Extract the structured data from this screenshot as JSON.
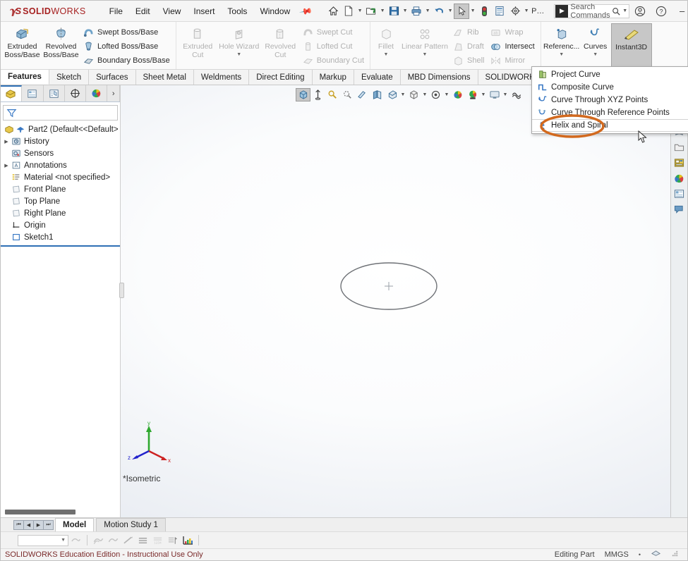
{
  "app": {
    "brand_ds": "2S",
    "brand_solid": "SOLID",
    "brand_works": "WORKS",
    "accent_color": "#a62121",
    "highlight_color": "#d2691e"
  },
  "menubar": {
    "items": [
      {
        "label": "File",
        "name": "menu-file"
      },
      {
        "label": "Edit",
        "name": "menu-edit"
      },
      {
        "label": "View",
        "name": "menu-view"
      },
      {
        "label": "Insert",
        "name": "menu-insert"
      },
      {
        "label": "Tools",
        "name": "menu-tools"
      },
      {
        "label": "Window",
        "name": "menu-window"
      }
    ],
    "pin_icon": "pin-icon"
  },
  "quick_access": {
    "icons": [
      {
        "name": "home-icon",
        "glyph": "⌂"
      },
      {
        "name": "new-document-icon",
        "glyph": "□"
      },
      {
        "name": "open-folder-icon",
        "glyph": "▶"
      },
      {
        "name": "save-icon",
        "glyph": "■"
      },
      {
        "name": "print-icon",
        "glyph": "⎙"
      },
      {
        "name": "undo-icon",
        "glyph": "↶"
      },
      {
        "name": "select-arrow-icon",
        "glyph": "➤"
      },
      {
        "name": "rebuild-traffic-icon",
        "glyph": "●"
      },
      {
        "name": "options-list-icon",
        "glyph": "☰"
      },
      {
        "name": "settings-gear-icon",
        "glyph": "⚙"
      },
      {
        "name": "part-label-icon",
        "glyph": "P…"
      }
    ]
  },
  "search": {
    "placeholder": "Search Commands",
    "search_icon": "magnifier-icon",
    "dropdown_icon": "chevron-down-icon",
    "swk_icon": "solidworks-search-icon"
  },
  "window_controls": {
    "account_icon": "user-account-icon",
    "help_icon": "help-question-icon",
    "minimize": "–",
    "maximize": "☐",
    "close": "✕"
  },
  "ribbon": {
    "groups": [
      {
        "name": "boss-base-group",
        "big": [
          {
            "label_line1": "Extruded",
            "label_line2": "Boss/Base",
            "name": "extruded-boss-base-button",
            "disabled": false
          },
          {
            "label_line1": "Revolved",
            "label_line2": "Boss/Base",
            "name": "revolved-boss-base-button",
            "disabled": false
          }
        ],
        "small": [
          {
            "label": "Swept Boss/Base",
            "name": "swept-boss-base-button",
            "disabled": false
          },
          {
            "label": "Lofted Boss/Base",
            "name": "lofted-boss-base-button",
            "disabled": false
          },
          {
            "label": "Boundary Boss/Base",
            "name": "boundary-boss-base-button",
            "disabled": false
          }
        ]
      },
      {
        "name": "cut-group",
        "big": [
          {
            "label_line1": "Extruded",
            "label_line2": "Cut",
            "name": "extruded-cut-button",
            "disabled": true
          },
          {
            "label_line1": "Hole Wizard",
            "label_line2": "",
            "name": "hole-wizard-button",
            "disabled": true
          },
          {
            "label_line1": "Revolved",
            "label_line2": "Cut",
            "name": "revolved-cut-button",
            "disabled": true
          }
        ],
        "small": [
          {
            "label": "Swept Cut",
            "name": "swept-cut-button",
            "disabled": true
          },
          {
            "label": "Lofted Cut",
            "name": "lofted-cut-button",
            "disabled": true
          },
          {
            "label": "Boundary Cut",
            "name": "boundary-cut-button",
            "disabled": true
          }
        ]
      },
      {
        "name": "features-group",
        "big": [
          {
            "label_line1": "Fillet",
            "label_line2": "",
            "name": "fillet-button",
            "disabled": true
          },
          {
            "label_line1": "Linear Pattern",
            "label_line2": "",
            "name": "linear-pattern-button",
            "disabled": true
          }
        ],
        "small": [
          {
            "label": "Rib",
            "name": "rib-button",
            "disabled": true
          },
          {
            "label": "Draft",
            "name": "draft-button",
            "disabled": true
          },
          {
            "label": "Shell",
            "name": "shell-button",
            "disabled": true
          }
        ],
        "small2": [
          {
            "label": "Wrap",
            "name": "wrap-button",
            "disabled": true
          },
          {
            "label": "Intersect",
            "name": "intersect-button",
            "disabled": false
          },
          {
            "label": "Mirror",
            "name": "mirror-button",
            "disabled": true
          }
        ]
      },
      {
        "name": "geometry-group",
        "big": [
          {
            "label_line1": "Referenc...",
            "label_line2": "",
            "name": "reference-geometry-button",
            "disabled": false
          },
          {
            "label_line1": "Curves",
            "label_line2": "",
            "name": "curves-button",
            "disabled": false
          },
          {
            "label_line1": "Instant3D",
            "label_line2": "",
            "name": "instant3d-button",
            "disabled": false
          }
        ]
      }
    ],
    "tabs": [
      {
        "label": "Features",
        "name": "tab-features",
        "active": true
      },
      {
        "label": "Sketch",
        "name": "tab-sketch",
        "active": false
      },
      {
        "label": "Surfaces",
        "name": "tab-surfaces",
        "active": false
      },
      {
        "label": "Sheet Metal",
        "name": "tab-sheet-metal",
        "active": false
      },
      {
        "label": "Weldments",
        "name": "tab-weldments",
        "active": false
      },
      {
        "label": "Direct Editing",
        "name": "tab-direct-editing",
        "active": false
      },
      {
        "label": "Markup",
        "name": "tab-markup",
        "active": false
      },
      {
        "label": "Evaluate",
        "name": "tab-evaluate",
        "active": false
      },
      {
        "label": "MBD Dimensions",
        "name": "tab-mbd-dimensions",
        "active": false
      },
      {
        "label": "SOLIDWORKS Add-Ins",
        "name": "tab-solidworks-add-ins",
        "active": false
      }
    ]
  },
  "curves_dropdown": {
    "items": [
      {
        "label": "Project Curve",
        "name": "menu-item-project-curve",
        "icon": "project-curve-icon",
        "highlighted": false
      },
      {
        "label": "Composite Curve",
        "name": "menu-item-composite-curve",
        "icon": "composite-curve-icon",
        "highlighted": false
      },
      {
        "label": "Curve Through XYZ Points",
        "name": "menu-item-curve-through-xyz-points",
        "icon": "curve-xyz-icon",
        "highlighted": false
      },
      {
        "label": "Curve Through Reference Points",
        "name": "menu-item-curve-through-reference-points",
        "icon": "curve-reference-icon",
        "highlighted": false
      },
      {
        "label": "Helix and Spiral",
        "name": "menu-item-helix-and-spiral",
        "icon": "helix-spiral-icon",
        "highlighted": true
      }
    ]
  },
  "feature_tree": {
    "tabs": [
      {
        "name": "tab-feature-manager-tree",
        "icon": "yellow-part-icon",
        "active": true
      },
      {
        "name": "tab-property-manager",
        "icon": "property-manager-icon",
        "active": false
      },
      {
        "name": "tab-configuration-manager",
        "icon": "configuration-manager-icon",
        "active": false
      },
      {
        "name": "tab-dimxpert-manager",
        "icon": "dimxpert-icon",
        "active": false
      },
      {
        "name": "tab-display-manager",
        "icon": "display-manager-icon",
        "active": false
      },
      {
        "name": "tab-more",
        "icon": "chevron-right-icon",
        "active": false
      }
    ],
    "filter_icon": "filter-funnel-icon",
    "nodes": [
      {
        "label": "Part2  (Default<<Default>",
        "name": "tree-node-part2",
        "indent": 0,
        "expandable": false,
        "icon": "part-icon",
        "root": true
      },
      {
        "label": "History",
        "name": "tree-node-history",
        "indent": 1,
        "expandable": true,
        "icon": "history-icon"
      },
      {
        "label": "Sensors",
        "name": "tree-node-sensors",
        "indent": 1,
        "expandable": false,
        "icon": "sensors-icon"
      },
      {
        "label": "Annotations",
        "name": "tree-node-annotations",
        "indent": 1,
        "expandable": true,
        "icon": "annotations-icon"
      },
      {
        "label": "Material <not specified>",
        "name": "tree-node-material",
        "indent": 1,
        "expandable": false,
        "icon": "material-icon"
      },
      {
        "label": "Front Plane",
        "name": "tree-node-front-plane",
        "indent": 1,
        "expandable": false,
        "icon": "plane-icon"
      },
      {
        "label": "Top Plane",
        "name": "tree-node-top-plane",
        "indent": 1,
        "expandable": false,
        "icon": "plane-icon"
      },
      {
        "label": "Right Plane",
        "name": "tree-node-right-plane",
        "indent": 1,
        "expandable": false,
        "icon": "plane-icon"
      },
      {
        "label": "Origin",
        "name": "tree-node-origin",
        "indent": 1,
        "expandable": false,
        "icon": "origin-icon"
      },
      {
        "label": "Sketch1",
        "name": "tree-node-sketch1",
        "indent": 1,
        "expandable": false,
        "icon": "sketch-icon"
      }
    ]
  },
  "view_toolbar": {
    "icons": [
      {
        "name": "zoom-to-fit-icon",
        "selected": true
      },
      {
        "name": "zoom-to-area-icon",
        "selected": false
      },
      {
        "name": "previous-view-icon",
        "selected": false
      },
      {
        "name": "section-view-icon",
        "selected": false
      },
      {
        "name": "view-orientation-icon",
        "selected": false
      },
      {
        "name": "display-style-icon",
        "selected": false
      },
      {
        "name": "hide-show-items-icon",
        "selected": false
      },
      {
        "name": "edit-appearance-icon",
        "selected": false
      },
      {
        "name": "apply-scene-icon",
        "selected": false
      },
      {
        "name": "view-settings-icon",
        "selected": false
      }
    ]
  },
  "graphics": {
    "view_label": "Isometric",
    "triad": {
      "x_label": "x",
      "y_label": "y",
      "z_label": "z",
      "x_color": "#cc2222",
      "y_color": "#22aa22",
      "z_color": "#2222cc"
    },
    "sketch_entity": "ellipse-sketch",
    "origin_marker": "origin-crosshair"
  },
  "task_pane": {
    "icons": [
      {
        "name": "design-library-icon"
      },
      {
        "name": "file-explorer-icon"
      },
      {
        "name": "view-palette-icon"
      },
      {
        "name": "appearances-scenes-icon"
      },
      {
        "name": "custom-properties-icon"
      },
      {
        "name": "solidworks-forum-icon"
      }
    ]
  },
  "bottom": {
    "nav_buttons": [
      "⏮",
      "◀",
      "▶",
      "⏭"
    ],
    "tabs": [
      {
        "label": "Model",
        "name": "bottom-tab-model",
        "active": true
      },
      {
        "label": "Motion Study 1",
        "name": "bottom-tab-motion-study-1",
        "active": false
      }
    ],
    "toolbar_icons": [
      {
        "name": "sketch-combo-dropdown"
      },
      {
        "name": "shaded-sketch-contours-icon"
      },
      {
        "name": "display-sketch-1-icon"
      },
      {
        "name": "display-sketch-2-icon"
      },
      {
        "name": "edit-line-icon"
      },
      {
        "name": "lines-icon"
      },
      {
        "name": "dimension-icon"
      },
      {
        "name": "flag-icon"
      },
      {
        "name": "color-chart-icon"
      }
    ]
  },
  "status_bar": {
    "education_notice": "SOLIDWORKS Education Edition - Instructional Use Only",
    "editing_state": "Editing Part",
    "units": "MMGS",
    "units_caret": "•",
    "overlay_icon": "layers-icon",
    "resize_grip": "resize-grip-icon"
  }
}
